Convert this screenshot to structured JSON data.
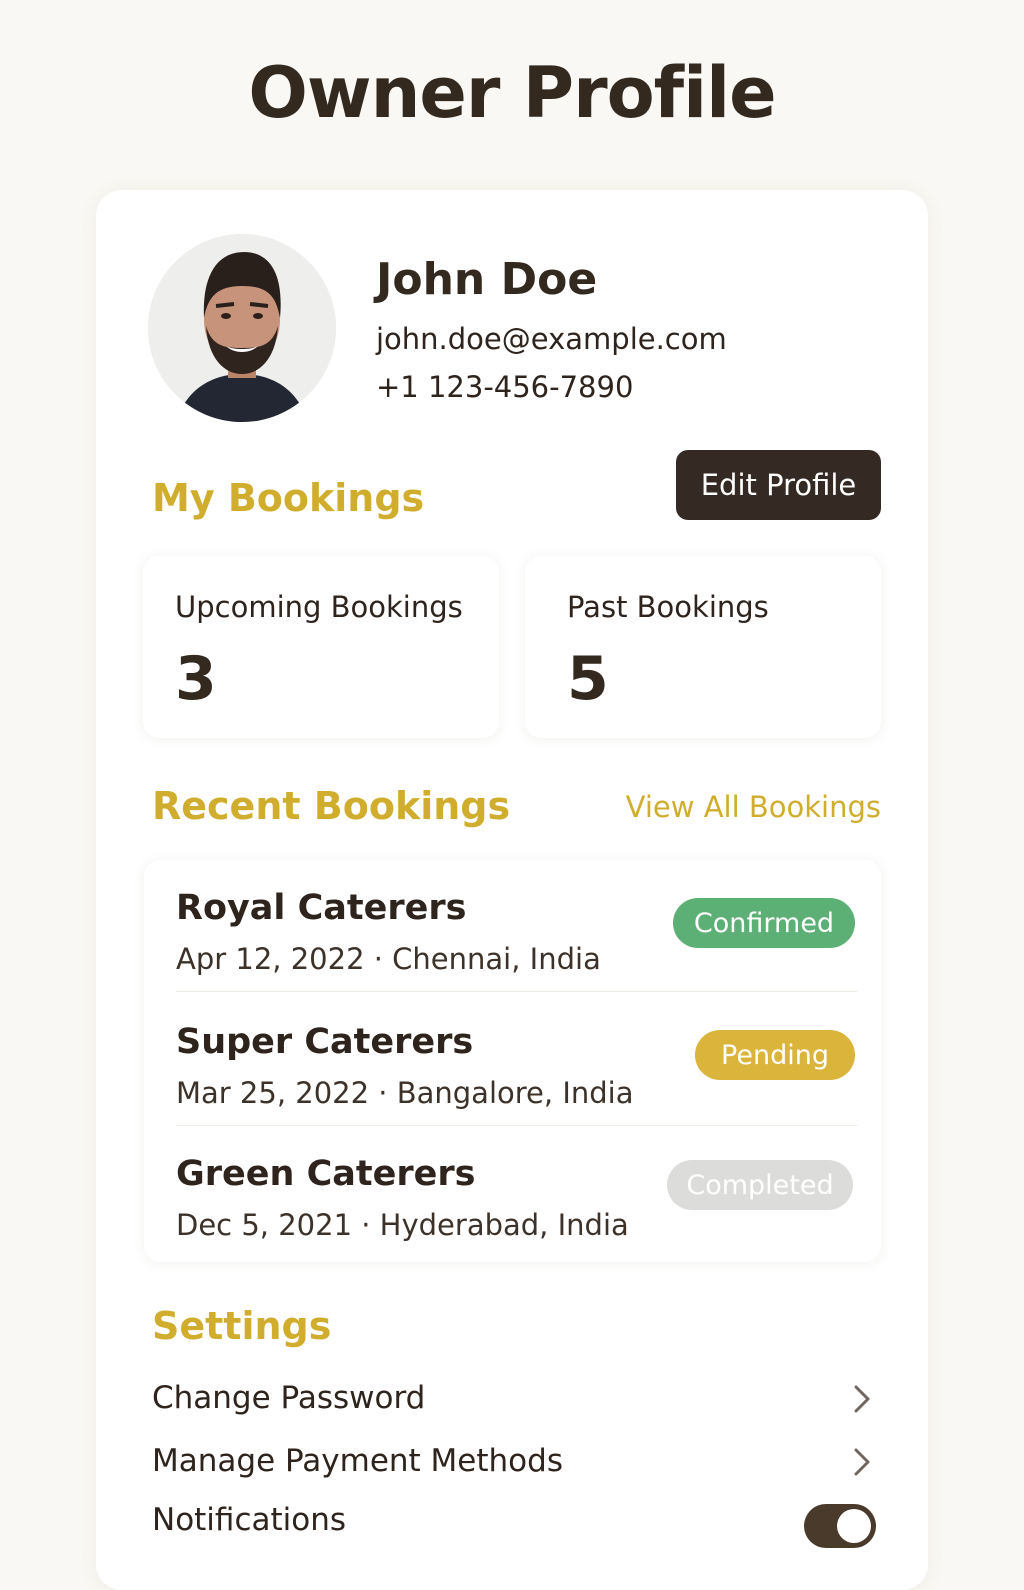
{
  "page": {
    "title": "Owner Profile"
  },
  "profile": {
    "name": "John Doe",
    "email": "john.doe@example.com",
    "phone": "+1 123-456-7890",
    "edit_button": "Edit Profile"
  },
  "my_bookings": {
    "title": "My Bookings",
    "upcoming": {
      "label": "Upcoming Bookings",
      "value": "3"
    },
    "past": {
      "label": "Past Bookings",
      "value": "5"
    }
  },
  "recent_bookings": {
    "title": "Recent Bookings",
    "view_all": "View All Bookings",
    "items": [
      {
        "name": "Royal Caterers",
        "meta": "Apr 12, 2022 · Chennai, India",
        "status": "Confirmed",
        "status_color": "#5caf75"
      },
      {
        "name": "Super Caterers",
        "meta": "Mar 25, 2022 · Bangalore, India",
        "status": "Pending",
        "status_color": "#dbb43c"
      },
      {
        "name": "Green Caterers",
        "meta": "Dec 5, 2021 · Hyderabad, India",
        "status": "Completed",
        "status_color": "#dcdcda"
      }
    ]
  },
  "settings": {
    "title": "Settings",
    "items": [
      {
        "label": "Change Password",
        "control": "chevron-right-icon"
      },
      {
        "label": "Manage Payment Methods",
        "control": "chevron-right-icon"
      },
      {
        "label": "Notifications",
        "control": "toggle-on"
      }
    ]
  },
  "colors": {
    "accent": "#d1ad2e",
    "dark": "#352a23",
    "background": "#faf8f4"
  }
}
